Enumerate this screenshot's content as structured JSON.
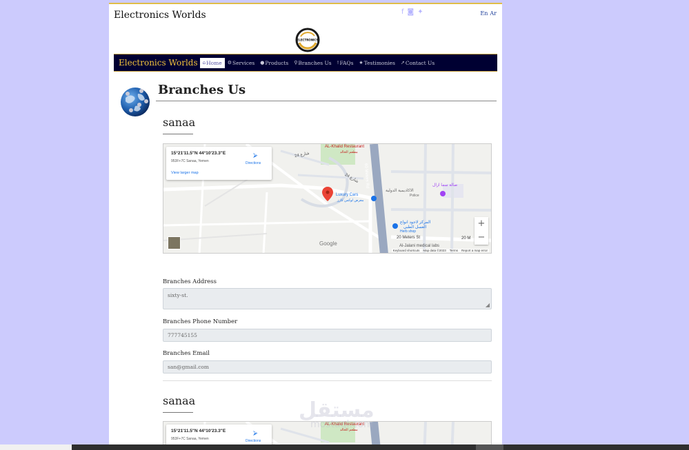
{
  "header": {
    "site_title": "Electronics Worlds",
    "social_icons": [
      "facebook-icon",
      "instagram-icon",
      "twitter-icon"
    ],
    "lang": {
      "en": "En",
      "ar": "Ar"
    },
    "logo_text": "ELECTRONICS"
  },
  "navbar": {
    "brand": "Electronics Worlds",
    "items": [
      {
        "icon": "home-icon",
        "glyph": "⌂",
        "label": "Home",
        "active": true
      },
      {
        "icon": "cogs-icon",
        "glyph": "⚙",
        "label": "Services",
        "active": false
      },
      {
        "icon": "circle-icon",
        "glyph": "●",
        "label": "Products",
        "active": false
      },
      {
        "icon": "map-marker-icon",
        "glyph": "⚲",
        "label": "Branches Us",
        "active": false
      },
      {
        "icon": "info-icon",
        "glyph": "!",
        "label": "FAQs",
        "active": false
      },
      {
        "icon": "star-icon",
        "glyph": "★",
        "label": "Testimonies",
        "active": false
      },
      {
        "icon": "rocket-icon",
        "glyph": "➚",
        "label": "Contact Us",
        "active": false
      }
    ]
  },
  "page": {
    "title": "Branches Us"
  },
  "map": {
    "coords": "15°21'11.5\"N 44°10'23.3\"E",
    "plus_code": "953F+7C Sanaa, Yemen",
    "larger_map": "View larger map",
    "directions": "Directions",
    "labels": {
      "restaurant": "AL-Khalid Restaurant",
      "restaurant_ar": "مطعم الخالد",
      "meters_rd": "60 Meters Rd",
      "luxury_cars": "Luxury Cars",
      "luxury_cars_ar": "معرض لوكس كارز",
      "academy_ar": "الاكاديمية الدولية",
      "police": "Police",
      "gym_ar": "صالة سما ازال",
      "herb_ar": "المركز لاجود انواع",
      "herb_ar2": "العسل الطبي",
      "herb_shop": "Herb shop",
      "meters_st": "20 Meters St",
      "meters_st_right": "20 M",
      "medical": "Al-Jalani medical labs",
      "street24": "24 شارع",
      "street24b": "شارع 24"
    },
    "google": "Google",
    "attrib": [
      "Keyboard shortcuts",
      "Map data ©2023",
      "Terms",
      "Report a map error"
    ]
  },
  "branches": [
    {
      "name": "sanaa",
      "address_label": "Branches Address",
      "address": "sixty-st.",
      "phone_label": "Branches Phone Number",
      "phone": "777745155",
      "email_label": "Branches Email",
      "email": "san@gmail.com"
    },
    {
      "name": "sanaa"
    }
  ],
  "watermark": {
    "text": "مستقل",
    "sub": "mostaql.com"
  },
  "colors": {
    "background": "#cccbfd",
    "navbar": "#000032",
    "accent": "#e0bd47",
    "brand": "#f2c23d"
  }
}
